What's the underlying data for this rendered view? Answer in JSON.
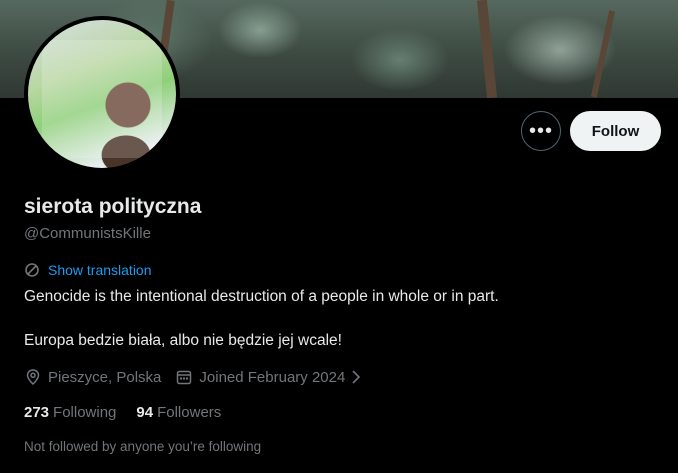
{
  "profile": {
    "display_name": "sierota polityczna",
    "handle": "@CommunistsKille",
    "show_translation": "Show translation",
    "bio_line1": "Genocide is the intentional destruction of a people in whole or in part.",
    "bio_line2": "Europa bedzie biała, albo nie będzie jej wcale!",
    "location": "Pieszyce, Polska",
    "joined": "Joined February 2024"
  },
  "actions": {
    "more_label": "•••",
    "follow_label": "Follow"
  },
  "stats": {
    "following_count": "273",
    "following_label": "Following",
    "followers_count": "94",
    "followers_label": "Followers"
  },
  "footer": {
    "not_followed_text": "Not followed by anyone you’re following"
  },
  "icons": {
    "translate": "translate-icon",
    "location": "location-pin-icon",
    "calendar": "calendar-icon",
    "chevron": "chevron-right-icon"
  },
  "colors": {
    "background": "#000000",
    "accent": "#1d9bf0",
    "secondary_text": "#71767b",
    "primary_text": "#e7e9ea"
  }
}
